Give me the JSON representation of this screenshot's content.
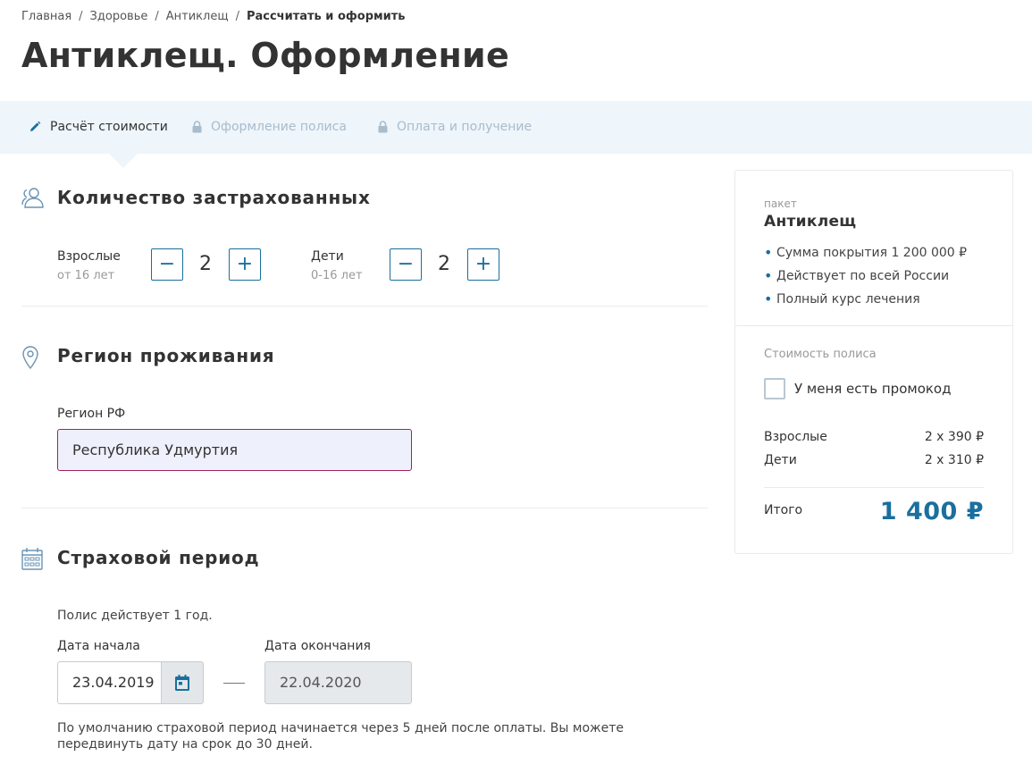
{
  "breadcrumb": {
    "items": [
      "Главная",
      "Здоровье",
      "Антиклещ"
    ],
    "separator": "/",
    "current": "Рассчитать и оформить"
  },
  "page_title": "Антиклещ. Оформление",
  "steps": [
    {
      "label": "Расчёт стоимости",
      "state": "active",
      "icon": "pencil-icon"
    },
    {
      "label": "Оформление полиса",
      "state": "locked",
      "icon": "lock-icon"
    },
    {
      "label": "Оплата и получение",
      "state": "locked",
      "icon": "lock-icon"
    }
  ],
  "insured": {
    "title": "Количество застрахованных",
    "icon": "users-icon",
    "adults": {
      "label": "Взрослые",
      "sub": "от 16 лет",
      "value": "2"
    },
    "children": {
      "label": "Дети",
      "sub": "0-16 лет",
      "value": "2"
    },
    "minus": "−",
    "plus": "+"
  },
  "region": {
    "title": "Регион проживания",
    "icon": "location-pin-icon",
    "field_label": "Регион РФ",
    "value": "Республика Удмуртия"
  },
  "period": {
    "title": "Страховой период",
    "icon": "calendar-icon",
    "info": "Полис действует 1 год.",
    "start_label": "Дата начала",
    "start_value": "23.04.2019",
    "end_label": "Дата окончания",
    "end_value": "22.04.2020",
    "note": "По умолчанию страховой период начинается через 5 дней после оплаты. Вы можете передвинуть дату на срок до 30 дней."
  },
  "summary": {
    "package_label": "пакет",
    "package_name": "Антиклещ",
    "features": [
      "Сумма покрытия 1 200 000 ₽",
      "Действует по всей России",
      "Полный курс лечения"
    ],
    "cost_label": "Стоимость полиса",
    "promo_label": "У меня есть промокод",
    "rows": [
      {
        "label": "Взрослые",
        "value": "2 x 390 ₽"
      },
      {
        "label": "Дети",
        "value": "2 x 310 ₽"
      }
    ],
    "total_label": "Итого",
    "total_value": "1 400 ₽"
  },
  "colors": {
    "accent": "#1a6f9e",
    "input_border_focus": "#a3215f",
    "steps_bg": "#eef5fb"
  }
}
